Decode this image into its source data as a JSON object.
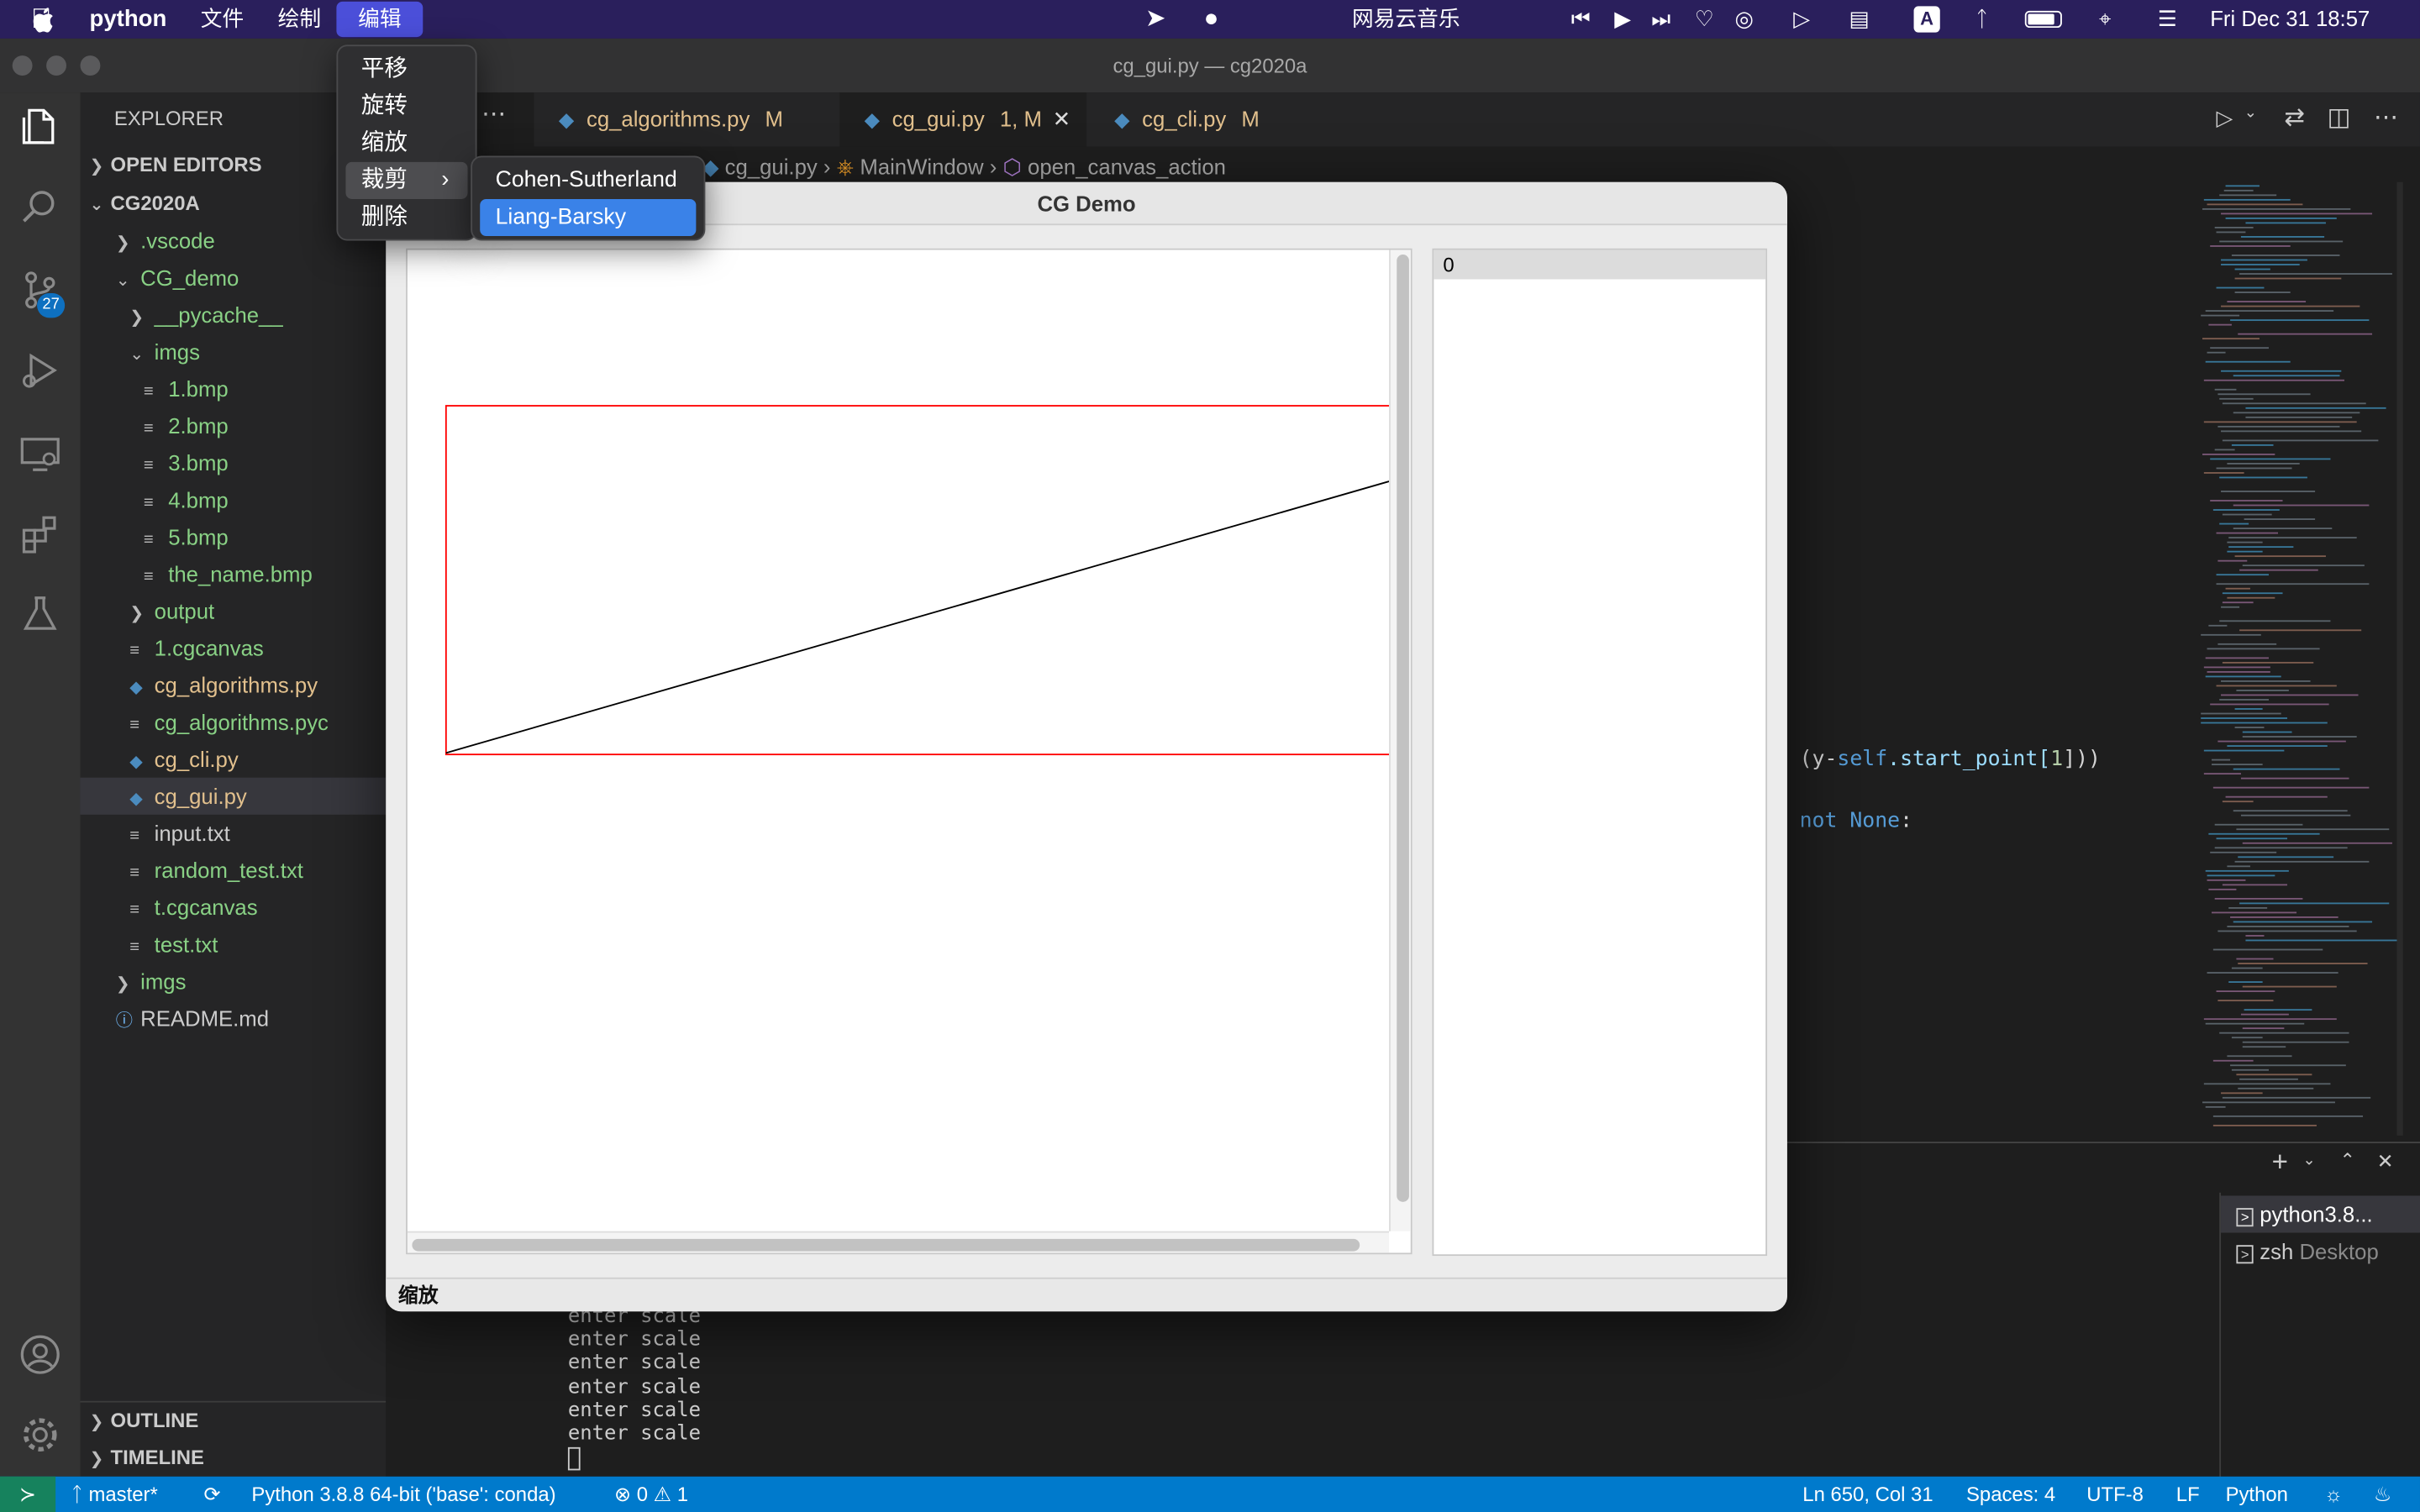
{
  "mac_menubar": {
    "app": "python",
    "items": [
      "文件",
      "绘制",
      "编辑"
    ],
    "music": "网易云音乐",
    "clock": "Fri Dec 31  18:57"
  },
  "window_title": "cg_gui.py — cg2020a",
  "explorer": {
    "title": "EXPLORER",
    "open_editors": "OPEN EDITORS",
    "root": "CG2020A",
    "tree": [
      {
        "label": ".vscode",
        "kind": "folder-closed",
        "depth": 1,
        "color": "green"
      },
      {
        "label": "CG_demo",
        "kind": "folder-open",
        "depth": 1,
        "color": "green"
      },
      {
        "label": "__pycache__",
        "kind": "folder-closed",
        "depth": 2,
        "color": "green"
      },
      {
        "label": "imgs",
        "kind": "folder-open",
        "depth": 2,
        "color": "green"
      },
      {
        "label": "1.bmp",
        "kind": "file",
        "depth": 3,
        "color": "green"
      },
      {
        "label": "2.bmp",
        "kind": "file",
        "depth": 3,
        "color": "green"
      },
      {
        "label": "3.bmp",
        "kind": "file",
        "depth": 3,
        "color": "green"
      },
      {
        "label": "4.bmp",
        "kind": "file",
        "depth": 3,
        "color": "green"
      },
      {
        "label": "5.bmp",
        "kind": "file",
        "depth": 3,
        "color": "green"
      },
      {
        "label": "the_name.bmp",
        "kind": "file",
        "depth": 3,
        "color": "green"
      },
      {
        "label": "output",
        "kind": "folder-closed",
        "depth": 2,
        "color": "green"
      },
      {
        "label": "1.cgcanvas",
        "kind": "file",
        "depth": 2,
        "color": "green"
      },
      {
        "label": "cg_algorithms.py",
        "kind": "python",
        "depth": 2,
        "color": "yellow"
      },
      {
        "label": "cg_algorithms.pyc",
        "kind": "file",
        "depth": 2,
        "color": "green"
      },
      {
        "label": "cg_cli.py",
        "kind": "python",
        "depth": 2,
        "color": "yellow"
      },
      {
        "label": "cg_gui.py",
        "kind": "python",
        "depth": 2,
        "color": "yellow",
        "selected": true
      },
      {
        "label": "input.txt",
        "kind": "file",
        "depth": 2,
        "color": "white"
      },
      {
        "label": "random_test.txt",
        "kind": "file",
        "depth": 2,
        "color": "green"
      },
      {
        "label": "t.cgcanvas",
        "kind": "file",
        "depth": 2,
        "color": "green"
      },
      {
        "label": "test.txt",
        "kind": "file",
        "depth": 2,
        "color": "green"
      },
      {
        "label": "imgs",
        "kind": "folder-closed",
        "depth": 1,
        "color": "green"
      },
      {
        "label": "README.md",
        "kind": "info",
        "depth": 1,
        "color": "white"
      }
    ],
    "outline": "OUTLINE",
    "timeline": "TIMELINE"
  },
  "activity": {
    "badge": "27"
  },
  "tabs": [
    {
      "label": "cg_algorithms.py",
      "badge": "M"
    },
    {
      "label": "cg_gui.py",
      "badge": "1, M"
    },
    {
      "label": "cg_cli.py",
      "badge": "M"
    }
  ],
  "breadcrumb": [
    "cg_gui.py",
    "MainWindow",
    "open_canvas_action"
  ],
  "code": {
    "line1_a": "(y-",
    "line1_b": "self",
    "line1_c": ".start_point[",
    "line1_d": "1",
    "line1_e": "]))",
    "line2_a": "not ",
    "line2_b": "None",
    ":": ":"
  },
  "terminal": {
    "lines": [
      "enter scale",
      "enter scale",
      "enter scale",
      "enter scale",
      "enter scale",
      "enter scale"
    ],
    "sessions": [
      {
        "name": "python3.8...",
        "detail": ""
      },
      {
        "name": "zsh",
        "detail": "Desktop"
      }
    ]
  },
  "cg_demo": {
    "title": "CG Demo",
    "list_header": "0",
    "status": "缩放"
  },
  "edit_menu": {
    "items": [
      "平移",
      "旋转",
      "缩放",
      "裁剪",
      "删除"
    ],
    "clip_submenu": [
      "Cohen-Sutherland",
      "Liang-Barsky"
    ]
  },
  "statusbar": {
    "branch": "master*",
    "interpreter": "Python 3.8.8 64-bit ('base': conda)",
    "errors": "0",
    "warnings": "1",
    "position": "Ln 650, Col 31",
    "spaces": "Spaces: 4",
    "encoding": "UTF-8",
    "eol": "LF",
    "language": "Python"
  }
}
